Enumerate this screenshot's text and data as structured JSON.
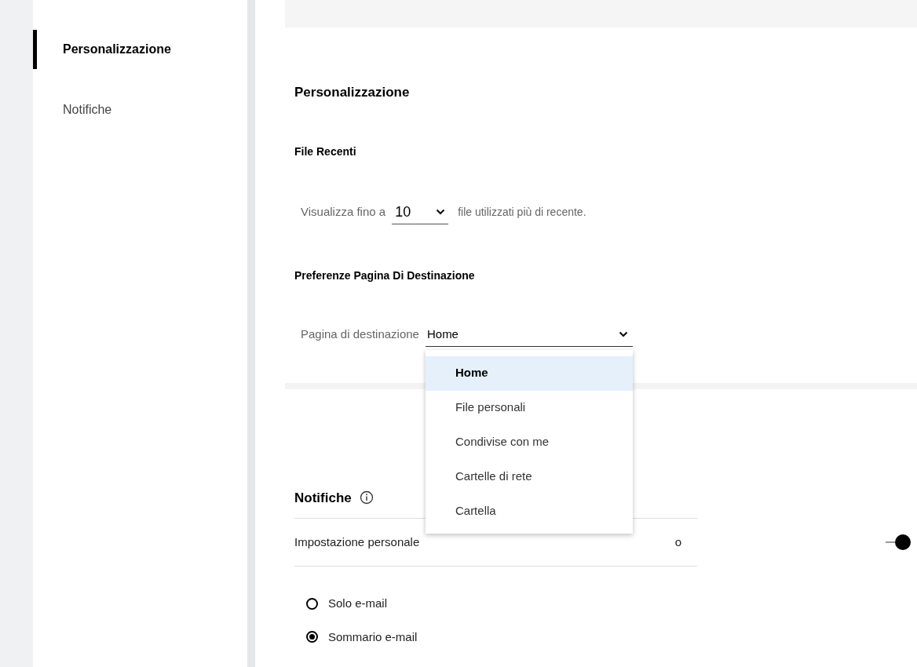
{
  "sidebar": {
    "items": [
      {
        "label": "Personalizzazione",
        "selected": true
      },
      {
        "label": "Notifiche",
        "selected": false
      }
    ]
  },
  "personalization": {
    "title": "Personalizzazione",
    "recent_files": {
      "title": "File Recenti",
      "prefix": "Visualizza fino a",
      "value": "10",
      "suffix": "file utilizzati più di recente."
    },
    "landing_page": {
      "title": "Preferenze Pagina Di Destinazione",
      "label": "Pagina di destinazione",
      "value": "Home",
      "expanded": true,
      "options": [
        {
          "label": "Home",
          "selected": true
        },
        {
          "label": "File personali",
          "selected": false
        },
        {
          "label": "Condivise con me",
          "selected": false
        },
        {
          "label": "Cartelle di rete",
          "selected": false
        },
        {
          "label": "Cartella",
          "selected": false
        }
      ]
    }
  },
  "notifications": {
    "title": "Notifiche",
    "setting": {
      "label_start": "Impostazione personale",
      "label_end": "o",
      "on": true
    },
    "options": [
      {
        "label": "Solo e-mail",
        "selected": false
      },
      {
        "label": "Sommario e-mail",
        "selected": true
      }
    ]
  }
}
